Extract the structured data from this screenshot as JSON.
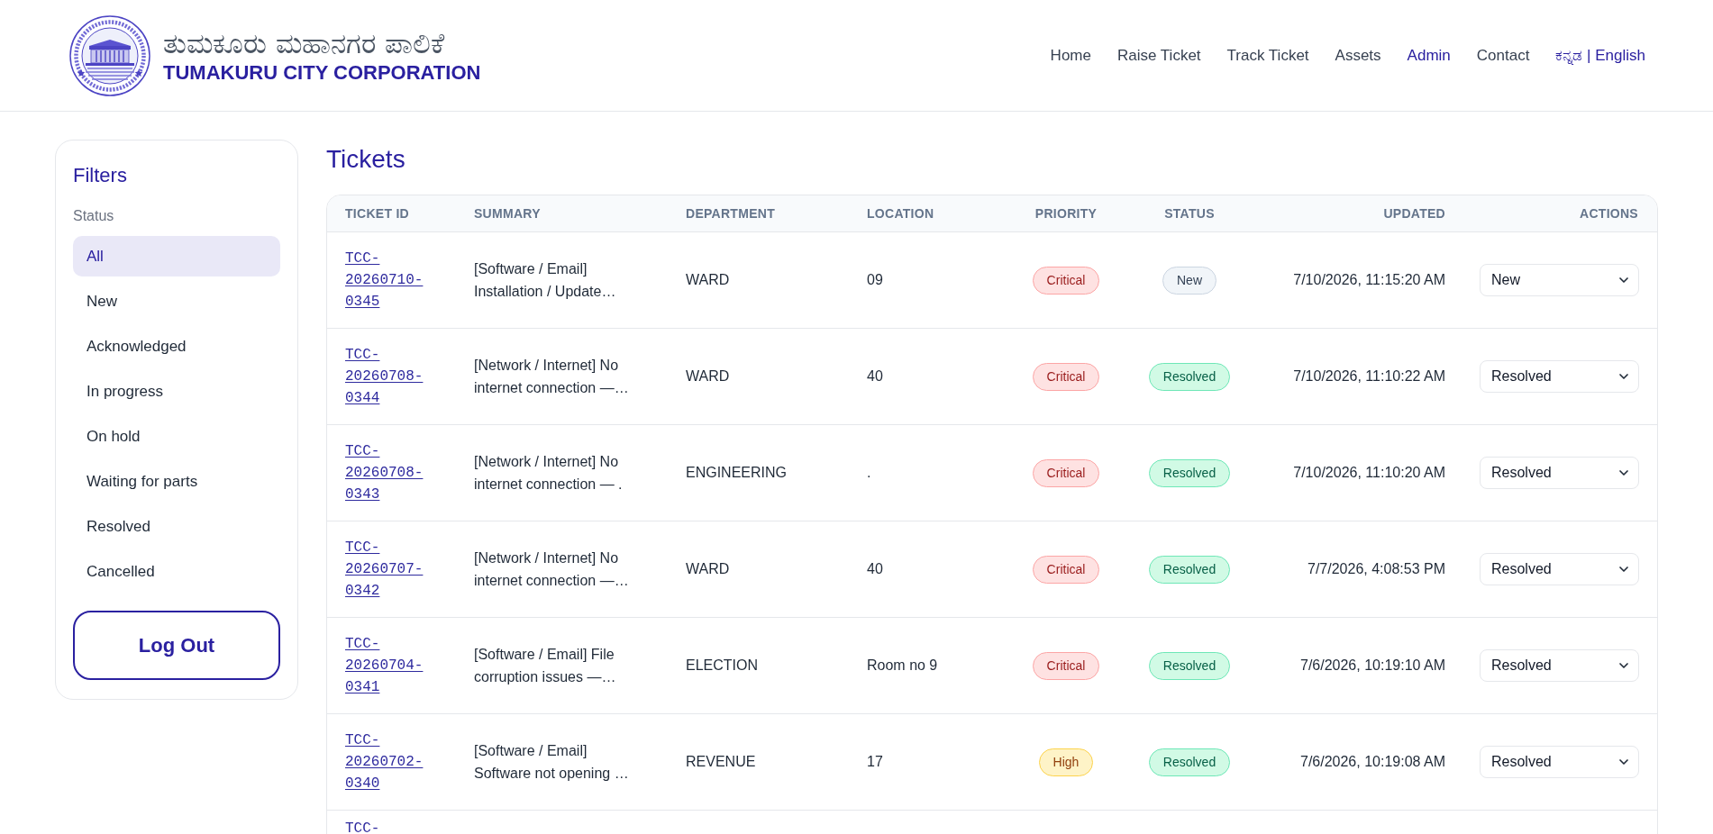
{
  "header": {
    "kannada_title": "ತುಮಕೂರು ಮಹಾನಗರ ಪಾಲಿಕೆ",
    "title": "TUMAKURU CITY CORPORATION",
    "nav": [
      {
        "label": "Home",
        "selected": false
      },
      {
        "label": "Raise Ticket",
        "selected": false
      },
      {
        "label": "Track Ticket",
        "selected": false
      },
      {
        "label": "Assets",
        "selected": false
      },
      {
        "label": "Admin",
        "selected": true
      },
      {
        "label": "Contact",
        "selected": false
      }
    ],
    "language_switch": "ಕನ್ನಡ | English"
  },
  "sidebar": {
    "title": "Filters",
    "group_label": "Status",
    "items": [
      {
        "label": "All",
        "selected": true
      },
      {
        "label": "New",
        "selected": false
      },
      {
        "label": "Acknowledged",
        "selected": false
      },
      {
        "label": "In progress",
        "selected": false
      },
      {
        "label": "On hold",
        "selected": false
      },
      {
        "label": "Waiting for parts",
        "selected": false
      },
      {
        "label": "Resolved",
        "selected": false
      },
      {
        "label": "Cancelled",
        "selected": false
      }
    ],
    "logout": "Log Out"
  },
  "tickets": {
    "title": "Tickets",
    "columns": [
      "TICKET ID",
      "SUMMARY",
      "DEPARTMENT",
      "LOCATION",
      "PRIORITY",
      "STATUS",
      "UPDATED",
      "ACTIONS"
    ],
    "rows": [
      {
        "ticket_id": "TCC-20260710-0345",
        "summary": "[Software / Email] Installation / Update…",
        "department": "WARD",
        "location": "09",
        "priority": {
          "label": "Critical",
          "kind": "critical"
        },
        "status": {
          "label": "New",
          "kind": "new"
        },
        "updated": "7/10/2026, 11:15:20 AM",
        "action": "New"
      },
      {
        "ticket_id": "TCC-20260708-0344",
        "summary": "[Network / Internet] No internet connection —…",
        "department": "WARD",
        "location": "40",
        "priority": {
          "label": "Critical",
          "kind": "critical"
        },
        "status": {
          "label": "Resolved",
          "kind": "resolved"
        },
        "updated": "7/10/2026, 11:10:22 AM",
        "action": "Resolved"
      },
      {
        "ticket_id": "TCC-20260708-0343",
        "summary": "[Network / Internet] No internet connection — .",
        "department": "ENGINEERING",
        "location": ".",
        "priority": {
          "label": "Critical",
          "kind": "critical"
        },
        "status": {
          "label": "Resolved",
          "kind": "resolved"
        },
        "updated": "7/10/2026, 11:10:20 AM",
        "action": "Resolved"
      },
      {
        "ticket_id": "TCC-20260707-0342",
        "summary": "[Network / Internet] No internet connection —…",
        "department": "WARD",
        "location": "40",
        "priority": {
          "label": "Critical",
          "kind": "critical"
        },
        "status": {
          "label": "Resolved",
          "kind": "resolved"
        },
        "updated": "7/7/2026, 4:08:53 PM",
        "action": "Resolved"
      },
      {
        "ticket_id": "TCC-20260704-0341",
        "summary": "[Software / Email] File corruption issues —…",
        "department": "ELECTION",
        "location": "Room no 9",
        "priority": {
          "label": "Critical",
          "kind": "critical"
        },
        "status": {
          "label": "Resolved",
          "kind": "resolved"
        },
        "updated": "7/6/2026, 10:19:10 AM",
        "action": "Resolved"
      },
      {
        "ticket_id": "TCC-20260702-0340",
        "summary": "[Software / Email] Software not opening …",
        "department": "REVENUE",
        "location": "17",
        "priority": {
          "label": "High",
          "kind": "high"
        },
        "status": {
          "label": "Resolved",
          "kind": "resolved"
        },
        "updated": "7/6/2026, 10:19:08 AM",
        "action": "Resolved"
      },
      {
        "ticket_id": "TCC-"
      }
    ]
  }
}
